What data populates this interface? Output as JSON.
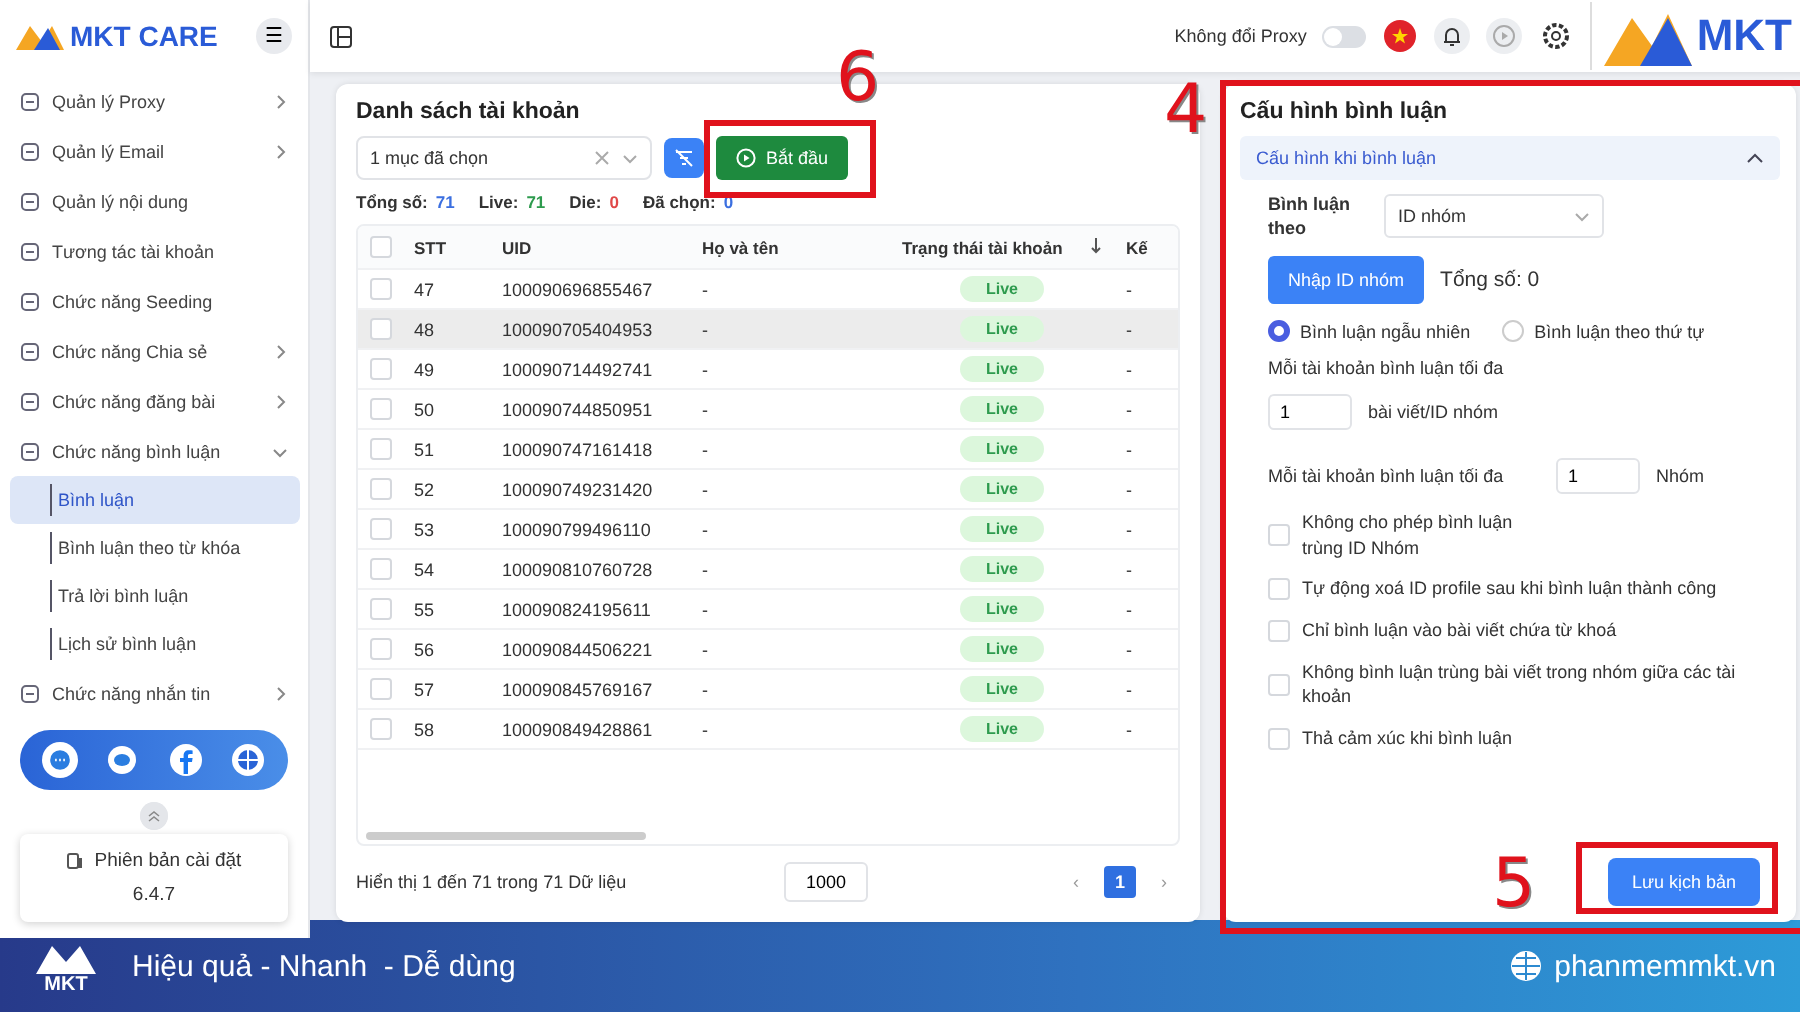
{
  "sidebar": {
    "brand": "MKT CARE",
    "menu_button": "☰",
    "items": [
      {
        "label": "Quản lý Proxy",
        "expanded": false
      },
      {
        "label": "Quản lý Email",
        "expanded": false
      },
      {
        "label": "Quản lý nội dung"
      },
      {
        "label": "Tương tác tài khoản"
      },
      {
        "label": "Chức năng Seeding"
      },
      {
        "label": "Chức năng Chia sẻ",
        "expanded": false
      },
      {
        "label": "Chức năng đăng bài",
        "expanded": false
      },
      {
        "label": "Chức năng bình luận",
        "expanded": true,
        "children": [
          {
            "label": "Bình luận",
            "selected": true
          },
          {
            "label": "Bình luận theo từ khóa",
            "selected": false
          },
          {
            "label": "Trả lời bình luận",
            "selected": false
          },
          {
            "label": "Lịch sử bình luận",
            "selected": false
          }
        ]
      },
      {
        "label": "Chức năng nhắn tin",
        "expanded": false
      }
    ],
    "version_label": "Phiên bản cài đặt",
    "version": "6.4.7"
  },
  "topbar": {
    "proxy_label": "Không đổi Proxy",
    "proxy_on": false,
    "logo": "MKT"
  },
  "accounts": {
    "title": "Danh sách tài khoản",
    "filter_value": "1 mục đã chọn",
    "start_button": "Bắt đầu",
    "stats": [
      {
        "label": "Tổng số:",
        "value": "71",
        "color": "#3b6fe0"
      },
      {
        "label": "Live:",
        "value": "71",
        "color": "#2e9b4e"
      },
      {
        "label": "Die:",
        "value": "0",
        "color": "#e04848"
      },
      {
        "label": "Đã chọn:",
        "value": "0",
        "color": "#3b6fe0"
      }
    ],
    "table": {
      "all_checked": false,
      "columns": [
        "STT",
        "UID",
        "Họ và tên",
        "Trạng thái tài khoản",
        "Kế"
      ],
      "rows": [
        {
          "cells": [
            "47",
            "100090696855467",
            "-",
            "Live",
            "-"
          ],
          "checked": false,
          "highlighted": false
        },
        {
          "cells": [
            "48",
            "100090705404953",
            "-",
            "Live",
            "-"
          ],
          "checked": false,
          "highlighted": true
        },
        {
          "cells": [
            "49",
            "100090714492741",
            "-",
            "Live",
            "-"
          ],
          "checked": false,
          "highlighted": false
        },
        {
          "cells": [
            "50",
            "100090744850951",
            "-",
            "Live",
            "-"
          ],
          "checked": false,
          "highlighted": false
        },
        {
          "cells": [
            "51",
            "100090747161418",
            "-",
            "Live",
            "-"
          ],
          "checked": false,
          "highlighted": false
        },
        {
          "cells": [
            "52",
            "100090749231420",
            "-",
            "Live",
            "-"
          ],
          "checked": false,
          "highlighted": false
        },
        {
          "cells": [
            "53",
            "100090799496110",
            "-",
            "Live",
            "-"
          ],
          "checked": false,
          "highlighted": false
        },
        {
          "cells": [
            "54",
            "100090810760728",
            "-",
            "Live",
            "-"
          ],
          "checked": false,
          "highlighted": false
        },
        {
          "cells": [
            "55",
            "100090824195611",
            "-",
            "Live",
            "-"
          ],
          "checked": false,
          "highlighted": false
        },
        {
          "cells": [
            "56",
            "100090844506221",
            "-",
            "Live",
            "-"
          ],
          "checked": false,
          "highlighted": false
        },
        {
          "cells": [
            "57",
            "100090845769167",
            "-",
            "Live",
            "-"
          ],
          "checked": false,
          "highlighted": false
        },
        {
          "cells": [
            "58",
            "100090849428861",
            "-",
            "Live",
            "-"
          ],
          "checked": false,
          "highlighted": false
        }
      ]
    },
    "footer": "Hiển thị 1 đến 71 trong 71 Dữ liệu",
    "page_size": "1000",
    "pages": [
      {
        "label": "‹",
        "selected": false
      },
      {
        "label": "1",
        "selected": true
      },
      {
        "label": "›",
        "selected": false
      }
    ]
  },
  "config": {
    "title": "Cấu hình bình luận",
    "section": "Cấu hình khi bình luận",
    "section_expanded": true,
    "by_label": "Bình luận theo",
    "by_value": "ID nhóm",
    "import_button": "Nhập ID nhóm",
    "total": "Tổng số: 0",
    "radios": [
      {
        "label": "Bình luận ngẫu nhiên",
        "selected": true
      },
      {
        "label": "Bình luận theo thứ tự",
        "selected": false
      }
    ],
    "max_posts_label": "Mỗi tài khoản bình luận tối đa",
    "max_posts": "1",
    "max_posts_unit": "bài viết/ID nhóm",
    "max_groups_label": "Mỗi tài khoản bình luận tối đa",
    "max_groups": "1",
    "max_groups_unit": "Nhóm",
    "options": [
      {
        "label": "Không cho phép bình luận trùng ID Nhóm",
        "checked": false
      },
      {
        "label": "Tự động xoá ID profile sau khi bình luận thành công",
        "checked": false
      },
      {
        "label": "Chỉ bình luận vào bài viết chứa từ khoá",
        "checked": false
      },
      {
        "label": "Không bình luận trùng bài viết trong nhóm giữa các tài khoản",
        "checked": false
      },
      {
        "label": "Thả cảm xúc khi bình luận",
        "checked": false
      }
    ],
    "save_button": "Lưu kịch bản"
  },
  "annotations": {
    "start_button": "6",
    "config_panel": "4",
    "save_button": "5"
  },
  "banner": {
    "logo": "MKT",
    "slogan": "Hiệu quả - Nhanh  - Dễ dùng",
    "website": "phanmemmkt.vn"
  }
}
